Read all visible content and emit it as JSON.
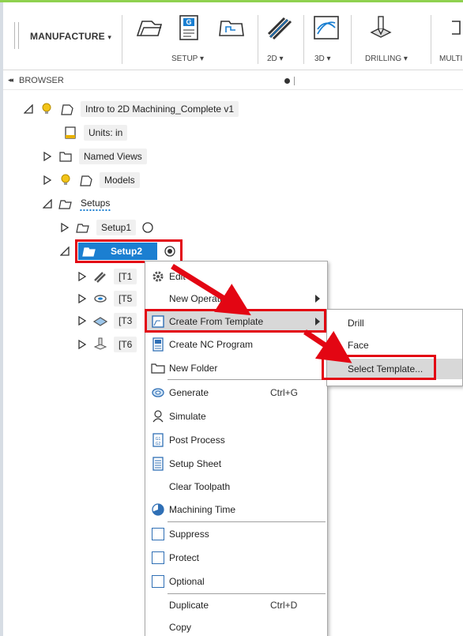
{
  "toolbar": {
    "workspace_label": "MANUFACTURE",
    "workspace_caret": "▾",
    "groups": [
      {
        "label": "SETUP ▾"
      },
      {
        "label": "2D ▾"
      },
      {
        "label": "3D ▾"
      },
      {
        "label": "DRILLING ▾"
      },
      {
        "label": "MULTI"
      }
    ]
  },
  "browser": {
    "collapse_glyph": "◂◂",
    "title": "BROWSER"
  },
  "tree": {
    "root": "Intro to 2D Machining_Complete v1",
    "units": "Units: in",
    "named_views": "Named Views",
    "models": "Models",
    "setups": "Setups",
    "setup1": "Setup1",
    "setup2": "Setup2",
    "op1": "[T1",
    "op2": "[T5",
    "op3": "[T3",
    "op4": "[T6"
  },
  "context_menu": {
    "items": [
      {
        "label": "Edit",
        "shortcut": ""
      },
      {
        "label": "New Operation",
        "shortcut": ""
      },
      {
        "label": "Create From Template",
        "shortcut": ""
      },
      {
        "label": "Create NC Program",
        "shortcut": ""
      },
      {
        "label": "New Folder",
        "shortcut": ""
      },
      {
        "label": "Generate",
        "shortcut": "Ctrl+G"
      },
      {
        "label": "Simulate",
        "shortcut": ""
      },
      {
        "label": "Post Process",
        "shortcut": ""
      },
      {
        "label": "Setup Sheet",
        "shortcut": ""
      },
      {
        "label": "Clear Toolpath",
        "shortcut": ""
      },
      {
        "label": "Machining Time",
        "shortcut": ""
      },
      {
        "label": "Suppress",
        "shortcut": ""
      },
      {
        "label": "Protect",
        "shortcut": ""
      },
      {
        "label": "Optional",
        "shortcut": ""
      },
      {
        "label": "Duplicate",
        "shortcut": "Ctrl+D"
      },
      {
        "label": "Copy",
        "shortcut": ""
      }
    ]
  },
  "submenu": {
    "items": [
      {
        "label": "Drill"
      },
      {
        "label": "Face"
      },
      {
        "label": "Select Template..."
      }
    ]
  },
  "colors": {
    "highlight_red": "#e30613",
    "selection_blue": "#1b7fd1",
    "accent_green": "#8fd14f"
  }
}
